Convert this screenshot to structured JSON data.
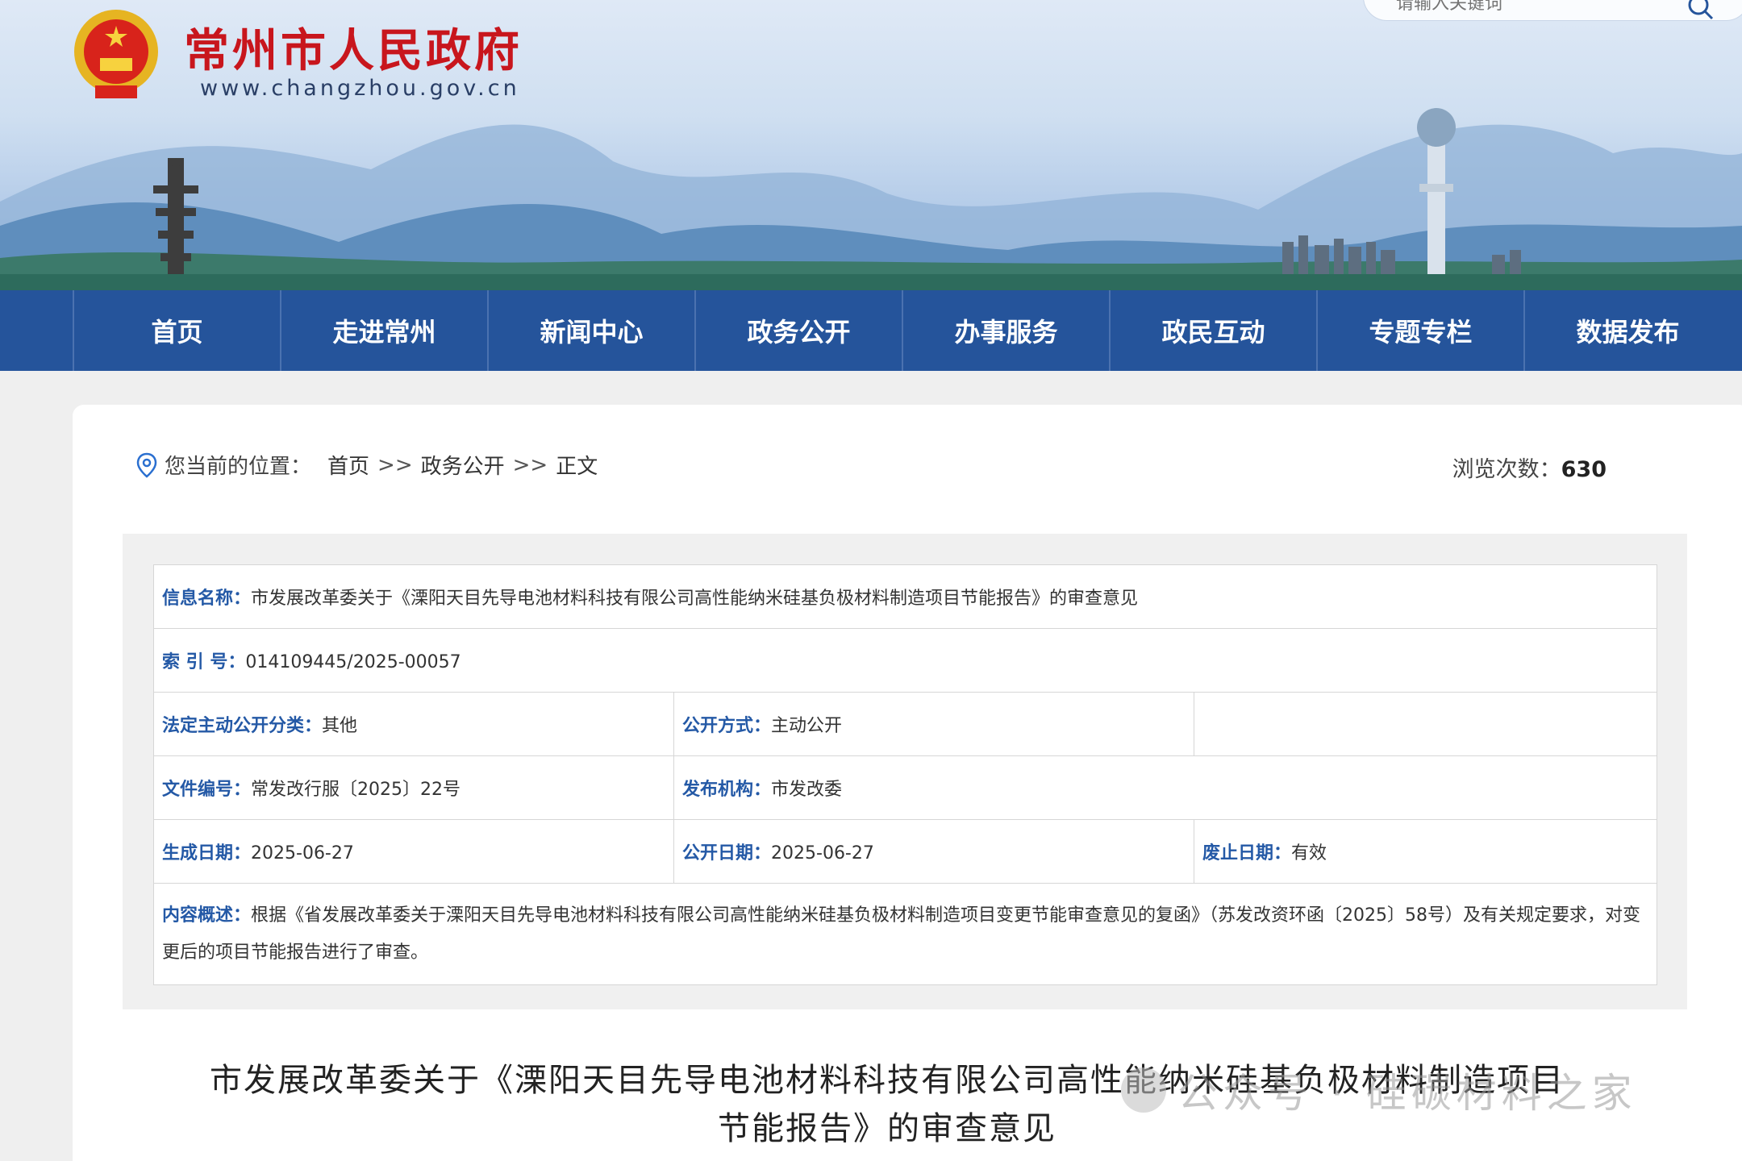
{
  "header": {
    "site_name": "常州市人民政府",
    "site_url": "www.changzhou.gov.cn",
    "search_placeholder": "请输入关键词"
  },
  "nav": {
    "items": [
      "首页",
      "走进常州",
      "新闻中心",
      "政务公开",
      "办事服务",
      "政民互动",
      "专题专栏",
      "数据发布"
    ]
  },
  "breadcrumb": {
    "label": "您当前的位置：",
    "items": [
      "首页",
      "政务公开",
      "正文"
    ],
    "separator": ">>"
  },
  "views": {
    "label": "浏览次数：",
    "count": "630"
  },
  "meta": {
    "name_label": "信息名称：",
    "name_value": "市发展改革委关于《溧阳天目先导电池材料科技有限公司高性能纳米硅基负极材料制造项目节能报告》的审查意见",
    "index_label": "索 引 号：",
    "index_value": "014109445/2025-00057",
    "category_label": "法定主动公开分类：",
    "category_value": "其他",
    "method_label": "公开方式：",
    "method_value": "主动公开",
    "docno_label": "文件编号：",
    "docno_value": "常发改行服〔2025〕22号",
    "issuer_label": "发布机构：",
    "issuer_value": "市发改委",
    "created_label": "生成日期：",
    "created_value": "2025-06-27",
    "published_label": "公开日期：",
    "published_value": "2025-06-27",
    "expiry_label": "废止日期：",
    "expiry_value": "有效",
    "summary_label": "内容概述：",
    "summary_value": "根据《省发展改革委关于溧阳天目先导电池材料科技有限公司高性能纳米硅基负极材料制造项目变更节能审查意见的复函》（苏发改资环函〔2025〕58号）及有关规定要求，对变更后的项目节能报告进行了审查。"
  },
  "document": {
    "title": "市发展改革委关于《溧阳天目先导电池材料科技有限公司高性能纳米硅基负极材料制造项目节能报告》的审查意见"
  },
  "watermark": {
    "text": "公众号 · 硅碳材料之家"
  },
  "colors": {
    "nav_bg": "#25549b",
    "label_blue": "#2459a6",
    "site_red": "#c8161d"
  },
  "icons": [
    "national-emblem-icon",
    "search-icon",
    "location-pin-icon"
  ]
}
